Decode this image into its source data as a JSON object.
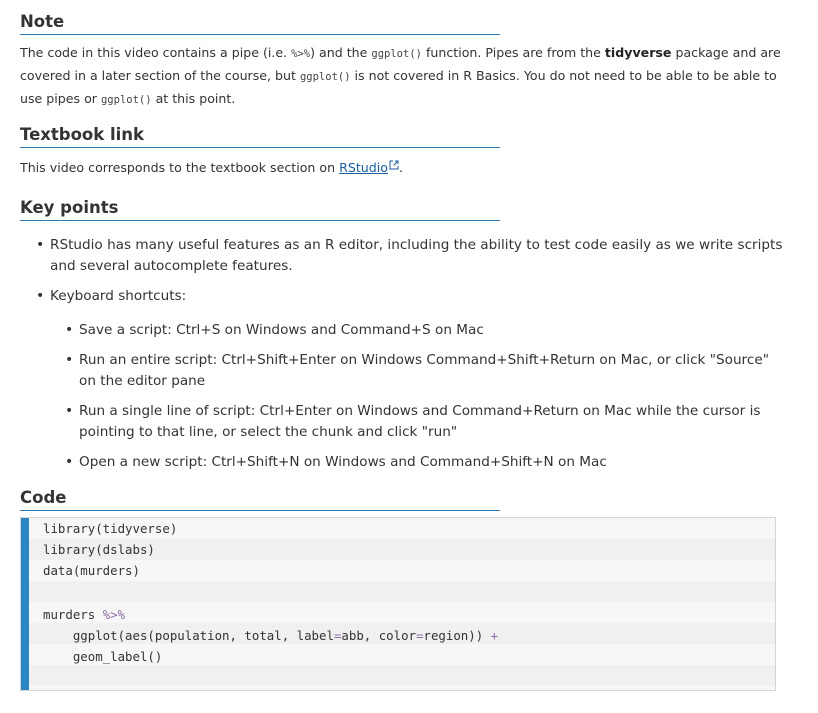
{
  "note": {
    "heading": "Note",
    "p1": "The code in this video contains a pipe (i.e. ",
    "pipe": "%>%",
    "p2": ") and the ",
    "ggplot": "ggplot()",
    "p3": " function. Pipes are from the ",
    "tidyverse": "tidyverse",
    "p4": " package and are covered in a later section of the course, but ",
    "p5": " is not covered in R Basics. You do not need to be able to be able to use pipes or ",
    "p6": " at this point."
  },
  "textbook": {
    "heading": "Textbook link",
    "text": "This video corresponds to the textbook section on ",
    "link": "RStudio",
    "end": "."
  },
  "keypoints": {
    "heading": "Key points",
    "items": [
      "RStudio has many useful features as an R editor, including the ability to test code easily as we write scripts and several autocomplete features.",
      "Keyboard shortcuts:"
    ],
    "sub_items": [
      "Save a script: Ctrl+S on Windows and Command+S on Mac",
      "Run an entire script:  Ctrl+Shift+Enter on Windows Command+Shift+Return on Mac, or click \"Source\" on the editor pane",
      "Run a single line of script: Ctrl+Enter on Windows and Command+Return on Mac while the cursor is pointing to that line, or select the chunk and click \"run\"",
      "Open a new script: Ctrl+Shift+N on Windows and Command+Shift+N on Mac"
    ]
  },
  "code": {
    "heading": "Code",
    "lines": [
      "library(tidyverse)",
      "library(dslabs)",
      "data(murders)",
      "",
      "murders ",
      "    ggplot(aes(population, total, label",
      "    geom_label()"
    ],
    "pipe_op": "%>%",
    "l6_eq": "=",
    "l6_mid": "abb, color",
    "l6_eq2": "=",
    "l6_end": "region)) ",
    "l6_plus": "+"
  },
  "colors": {
    "accent": "#2a7ab8",
    "code_bar": "#2b87c4",
    "link": "#1a5ea3"
  }
}
